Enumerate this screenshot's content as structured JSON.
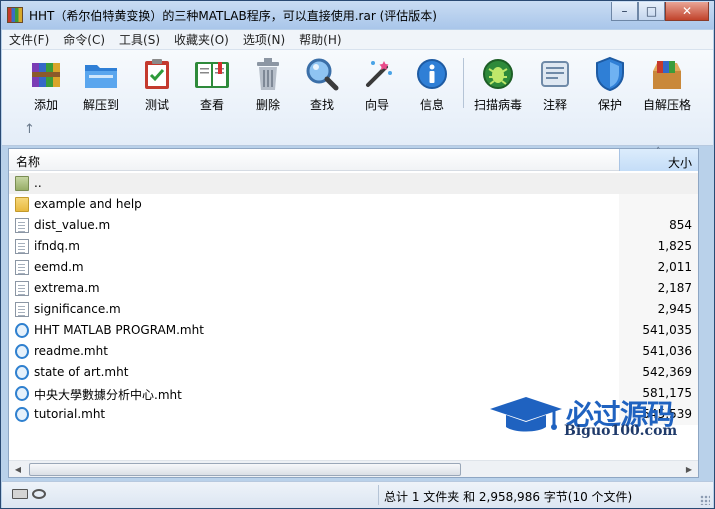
{
  "window": {
    "title": "HHT（希尔伯特黄变换）的三种MATLAB程序，可以直接使用.rar (评估版本)",
    "controls": {
      "minimize": "–",
      "maximize": "□",
      "close": "✕"
    }
  },
  "menu": [
    "文件(F)",
    "命令(C)",
    "工具(S)",
    "收藏夹(O)",
    "选项(N)",
    "帮助(H)"
  ],
  "toolbar": {
    "buttons": [
      {
        "label": "添加",
        "icon": "archive-add-icon"
      },
      {
        "label": "解压到",
        "icon": "folder-extract-icon"
      },
      {
        "label": "测试",
        "icon": "test-clipboard-icon"
      },
      {
        "label": "查看",
        "icon": "book-view-icon"
      },
      {
        "label": "删除",
        "icon": "trash-can-icon"
      },
      {
        "label": "查找",
        "icon": "magnifier-icon"
      },
      {
        "label": "向导",
        "icon": "magic-wand-icon"
      },
      {
        "label": "信息",
        "icon": "info-icon"
      },
      {
        "label": "扫描病毒",
        "icon": "bug-scan-icon"
      },
      {
        "label": "注释",
        "icon": "comment-icon"
      },
      {
        "label": "保护",
        "icon": "shield-icon"
      },
      {
        "label": "自解压格",
        "icon": "sfx-box-icon"
      }
    ],
    "up_arrow": "↑"
  },
  "file_list": {
    "columns": {
      "name": "名称",
      "size": "大小",
      "sort_indicator": "˄"
    },
    "rows": [
      {
        "name": "..",
        "size": "",
        "type": "parent"
      },
      {
        "name": "example and help",
        "size": "",
        "type": "folder"
      },
      {
        "name": "dist_value.m",
        "size": "854",
        "type": "file"
      },
      {
        "name": "ifndq.m",
        "size": "1,825",
        "type": "file"
      },
      {
        "name": "eemd.m",
        "size": "2,011",
        "type": "file"
      },
      {
        "name": "extrema.m",
        "size": "2,187",
        "type": "file"
      },
      {
        "name": "significance.m",
        "size": "2,945",
        "type": "file"
      },
      {
        "name": "HHT MATLAB PROGRAM.mht",
        "size": "541,035",
        "type": "mht"
      },
      {
        "name": "readme.mht",
        "size": "541,036",
        "type": "mht"
      },
      {
        "name": "state of art.mht",
        "size": "542,369",
        "type": "mht"
      },
      {
        "name": "中央大學數據分析中心.mht",
        "size": "581,175",
        "type": "mht"
      },
      {
        "name": "tutorial.mht",
        "size": "545,539",
        "type": "mht"
      }
    ]
  },
  "watermark": {
    "title": "必过源码",
    "subtitle": "Biguo100.com"
  },
  "status": {
    "summary": "总计 1 文件夹 和 2,958,986 字节(10 个文件)"
  },
  "colors": {
    "title_bar": "#b9d1ea",
    "header_sorted": "#c4ddf7",
    "watermark": "#1f62c0"
  }
}
